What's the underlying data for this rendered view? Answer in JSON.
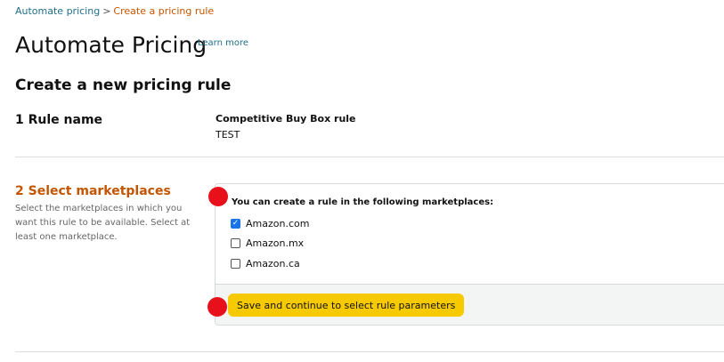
{
  "breadcrumb": {
    "root": "Automate pricing",
    "separator": ">",
    "current": "Create a pricing rule"
  },
  "page": {
    "title": "Automate Pricing",
    "learn_more": "Learn more",
    "section_heading": "Create a new pricing rule"
  },
  "step1": {
    "label": "1 Rule name",
    "rule_type": "Competitive Buy Box rule",
    "rule_name_value": "TEST"
  },
  "step2": {
    "label": "2 Select marketplaces",
    "help": "Select the marketplaces in which you want this rule to be available. Select at least one marketplace.",
    "panel_header": "You can create a rule in the following marketplaces:",
    "marketplaces": [
      {
        "label": "Amazon.com",
        "checked": true
      },
      {
        "label": "Amazon.mx",
        "checked": false
      },
      {
        "label": "Amazon.ca",
        "checked": false
      }
    ],
    "save_label": "Save and continue to select rule parameters"
  },
  "colors": {
    "link": "#1f6f8b",
    "accent_orange": "#c45500",
    "button_yellow": "#f7ca00",
    "checkbox_blue": "#1a73e8",
    "marker_red": "#e8101a"
  }
}
